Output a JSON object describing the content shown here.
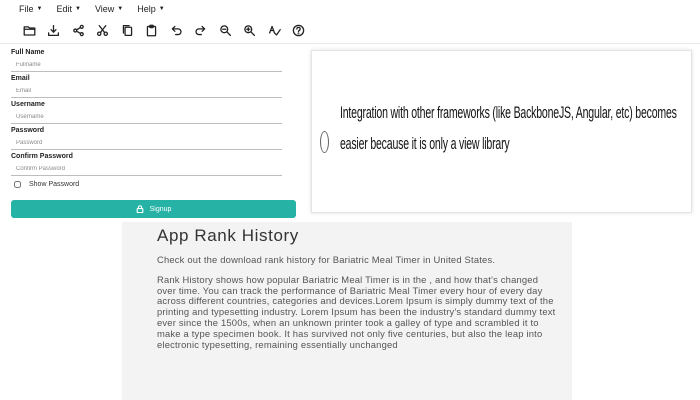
{
  "menubar": {
    "items": [
      {
        "label": "File"
      },
      {
        "label": "Edit"
      },
      {
        "label": "View"
      },
      {
        "label": "Help"
      }
    ]
  },
  "toolbar": {
    "buttons": [
      "folder-icon",
      "download-icon",
      "share-icon",
      "cut-icon",
      "copy-icon",
      "clipboard-icon",
      "undo-icon",
      "redo-icon",
      "zoom-out-icon",
      "zoom-in-icon",
      "spellcheck-icon",
      "help-icon"
    ]
  },
  "form": {
    "fields": [
      {
        "label": "Full Name",
        "placeholder": "Fullname"
      },
      {
        "label": "Email",
        "placeholder": "Email"
      },
      {
        "label": "Username",
        "placeholder": "Username"
      },
      {
        "label": "Password",
        "placeholder": "Password"
      },
      {
        "label": "Confirm Password",
        "placeholder": "Confirm Password"
      }
    ],
    "show_password_label": "Show Password",
    "signup_label": "Signup"
  },
  "quote": {
    "text": "Integration with other frameworks (like BackboneJS, Angular, etc) becomes easier because it is only a view library"
  },
  "rank": {
    "title": "App Rank History",
    "intro": "Check out the download rank history for Bariatric Meal Timer in United States.",
    "body": "Rank History shows how popular Bariatric Meal Timer is in the , and how that's changed over time. You can track the performance of Bariatric Meal Timer every hour of every day across different countries, categories and devices.Lorem Ipsum is simply dummy text of the printing and typesetting industry. Lorem Ipsum has been the industry's standard dummy text ever since the 1500s, when an unknown printer took a galley of type and scrambled it to make a type specimen book. It has survived not only five centuries, but also the leap into electronic typesetting, remaining essentially unchanged"
  },
  "colors": {
    "accent": "#26b3a6",
    "panel_bg": "#f3f3f3"
  }
}
